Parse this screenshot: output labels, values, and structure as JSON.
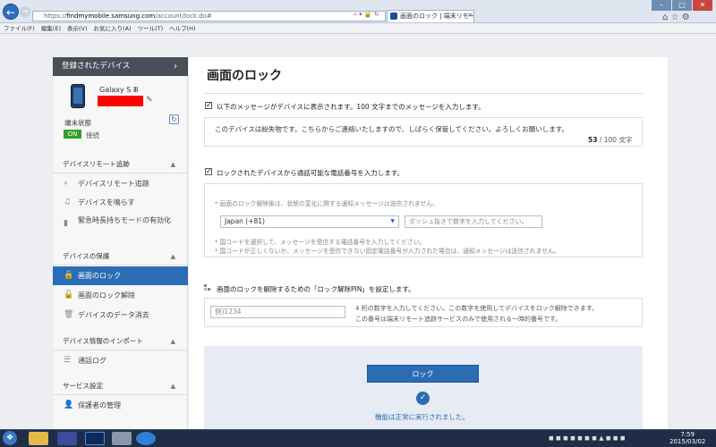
{
  "browser": {
    "url_prefix": "https://",
    "url_host": "findmymobile.samsung.com",
    "url_path": "/account/lock.do#",
    "tab_title": "画面のロック | 端末リモー...",
    "menu": [
      "ファイル(F)",
      "編集(E)",
      "表示(V)",
      "お気に入り(A)",
      "ツール(T)",
      "ヘルプ(H)"
    ]
  },
  "sidebar": {
    "registered_devices": "登録されたデバイス",
    "device_name": "Galaxy S Ⅲ",
    "status_label": "端末状態",
    "on_badge": "ON",
    "connected": "接続",
    "sections": [
      {
        "title": "デバイスリモート追跡",
        "items": [
          "デバイスリモート追跡",
          "デバイスを鳴らす",
          "緊急時長持ちモードの有効化"
        ]
      },
      {
        "title": "デバイスの保護",
        "items": [
          "画面のロック",
          "画面のロック解除",
          "デバイスのデータ消去"
        ]
      },
      {
        "title": "デバイス情報のインポート",
        "items": [
          "通話ログ"
        ]
      },
      {
        "title": "サービス設定",
        "items": [
          "保護者の管理"
        ]
      }
    ]
  },
  "main": {
    "title": "画面のロック",
    "message_option": "以下のメッセージがデバイスに表示されます。100 文字までのメッセージを入力します。",
    "message_text": "このデバイスは紛失物です。こちらからご連絡いたしますので、しばらく保管してください。よろしくお願いします。",
    "char_count": "53",
    "char_limit": "/ 100 文字",
    "phone_option": "ロックされたデバイスから通話可能な電話番号を入力します。",
    "phone_note_top": "* 画面のロック解除後は、状態の変化に関する通知メッセージは送信されません。",
    "country": "Japan (+81)",
    "phone_placeholder": "ダッシュ抜きで数字を入力してください。",
    "phone_note_1": "* 国コードを選択して、メッセージを受信する電話番号を入力してください。",
    "phone_note_2": "* 国コードが正しくないか、メッセージを受信できない固定電話番号が入力された場合は、通知メッセージは送信されません。",
    "pin_title": "画面のロックを解除するための「ロック解除PIN」を設定します。",
    "pin_placeholder": "例)1234",
    "pin_note_1": "4 桁の数字を入力してください。この数字を使用してデバイスをロック解除できます。",
    "pin_note_2": "この番号は端末リモート追跡サービスのみで使用される一時的番号です。",
    "lock_button": "ロック",
    "success_message": "機能は正常に実行されました。"
  },
  "taskbar": {
    "time": "7:59",
    "date": "2015/03/02"
  }
}
